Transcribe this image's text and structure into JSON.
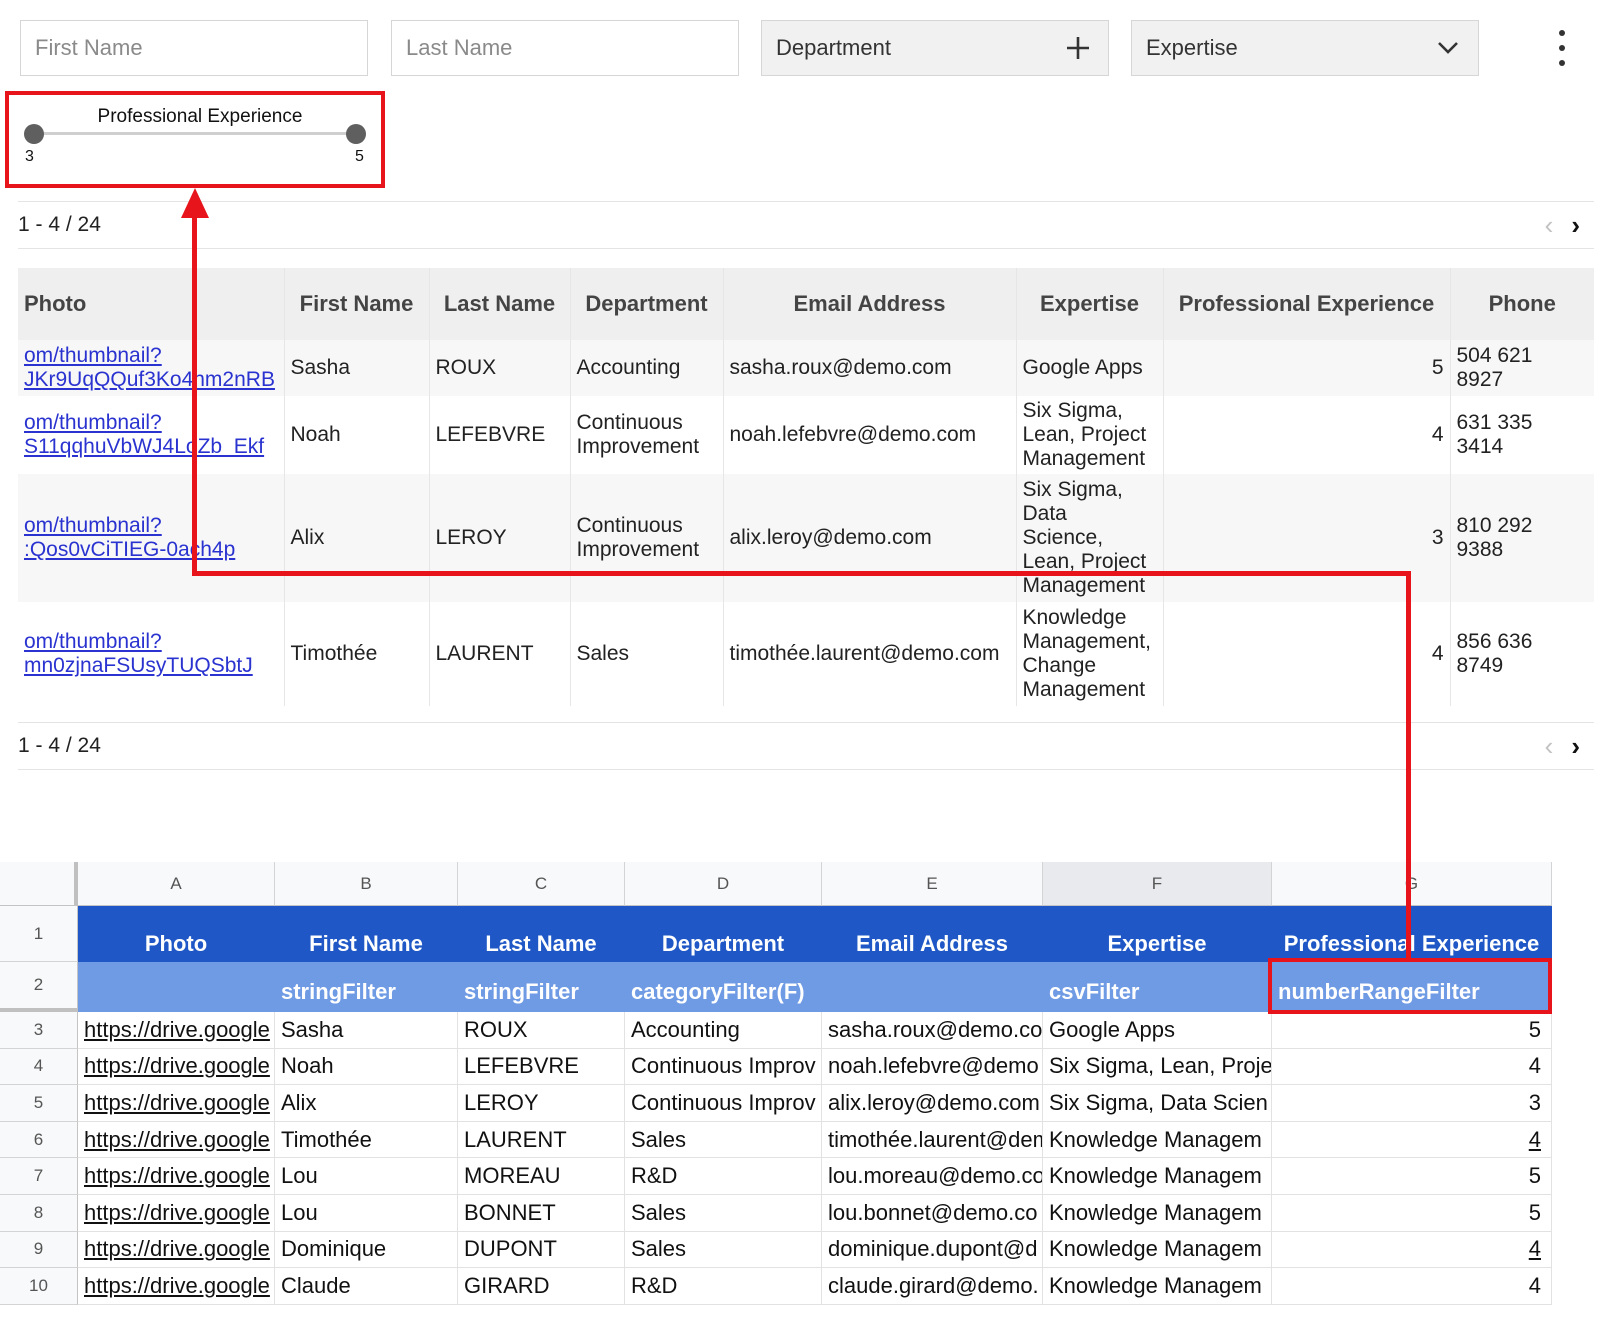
{
  "filters": {
    "first_name_placeholder": "First Name",
    "last_name_placeholder": "Last Name",
    "department_label": "Department",
    "expertise_label": "Expertise"
  },
  "slider": {
    "title": "Professional Experience",
    "min_value": "3",
    "max_value": "5",
    "min_fraction": 0.0,
    "max_fraction": 1.0
  },
  "pager_top": {
    "range": "1 - 4 / 24"
  },
  "pager_bottom": {
    "range": "1 - 4 / 24"
  },
  "table": {
    "headers": [
      "Photo",
      "First Name",
      "Last Name",
      "Department",
      "Email Address",
      "Expertise",
      "Professional Experience",
      "Phone"
    ],
    "rows": [
      {
        "photo": "om/thumbnail?\nJKr9UqQQuf3Ko4hm2nRB",
        "first": "Sasha",
        "last": "ROUX",
        "dept": "Accounting",
        "email": "sasha.roux@demo.com",
        "expertise": "Google Apps",
        "exp": "5",
        "phone": "504 621\n8927"
      },
      {
        "photo": "om/thumbnail?\nS11qqhuVbWJ4LoZb_Ekf",
        "first": "Noah",
        "last": "LEFEBVRE",
        "dept": "Continuous\nImprovement",
        "email": "noah.lefebvre@demo.com",
        "expertise": "Six Sigma,\nLean, Project\nManagement",
        "exp": "4",
        "phone": "631 335\n3414"
      },
      {
        "photo": "om/thumbnail?\n:Qos0vCiTIEG-0ach4p",
        "first": "Alix",
        "last": "LEROY",
        "dept": "Continuous\nImprovement",
        "email": "alix.leroy@demo.com",
        "expertise": "Six Sigma,\nData\nScience,\nLean, Project\nManagement",
        "exp": "3",
        "phone": "810 292\n9388"
      },
      {
        "photo": "om/thumbnail?\nmn0zjnaFSUsyTUQSbtJ",
        "first": "Timothée",
        "last": "LAURENT",
        "dept": "Sales",
        "email": "timothée.laurent@demo.com",
        "expertise": "Knowledge\nManagement,\nChange\nManagement",
        "exp": "4",
        "phone": "856 636\n8749"
      }
    ]
  },
  "sheet": {
    "columns": [
      "A",
      "B",
      "C",
      "D",
      "E",
      "F",
      "G"
    ],
    "row_numbers": [
      "1",
      "2",
      "3",
      "4",
      "5",
      "6",
      "7",
      "8",
      "9",
      "10"
    ],
    "header_row": [
      "Photo",
      "First Name",
      "Last Name",
      "Department",
      "Email Address",
      "Expertise",
      "Professional Experience"
    ],
    "filter_row": [
      "",
      "stringFilter",
      "stringFilter",
      "categoryFilter(F)",
      "",
      "csvFilter",
      "numberRangeFilter"
    ],
    "data_rows": [
      [
        "https://drive.google",
        "Sasha",
        "ROUX",
        "Accounting",
        "sasha.roux@demo.co",
        "Google Apps",
        "5"
      ],
      [
        "https://drive.google",
        "Noah",
        "LEFEBVRE",
        "Continuous Improv",
        "noah.lefebvre@demo",
        "Six Sigma, Lean, Proje",
        "4"
      ],
      [
        "https://drive.google",
        "Alix",
        "LEROY",
        "Continuous Improv",
        "alix.leroy@demo.com",
        "Six Sigma, Data Scien",
        "3"
      ],
      [
        "https://drive.google",
        "Timothée",
        "LAURENT",
        "Sales",
        "timothée.laurent@dem",
        "Knowledge Managem",
        "4"
      ],
      [
        "https://drive.google",
        "Lou",
        "MOREAU",
        "R&D",
        "lou.moreau@demo.co",
        "Knowledge Managem",
        "5"
      ],
      [
        "https://drive.google",
        "Lou",
        "BONNET",
        "Sales",
        "lou.bonnet@demo.co",
        "Knowledge Managem",
        "5"
      ],
      [
        "https://drive.google",
        "Dominique",
        "DUPONT",
        "Sales",
        "dominique.dupont@d",
        "Knowledge Managem",
        "4"
      ],
      [
        "https://drive.google",
        "Claude",
        "GIRARD",
        "R&D",
        "claude.girard@demo.",
        "Knowledge Managem",
        "4"
      ]
    ]
  },
  "colors": {
    "annotation_red": "#e8141b",
    "sheet_header_blue": "#1f58c6",
    "sheet_filter_blue": "#6f9ae4",
    "link_blue": "#2a33d0"
  }
}
